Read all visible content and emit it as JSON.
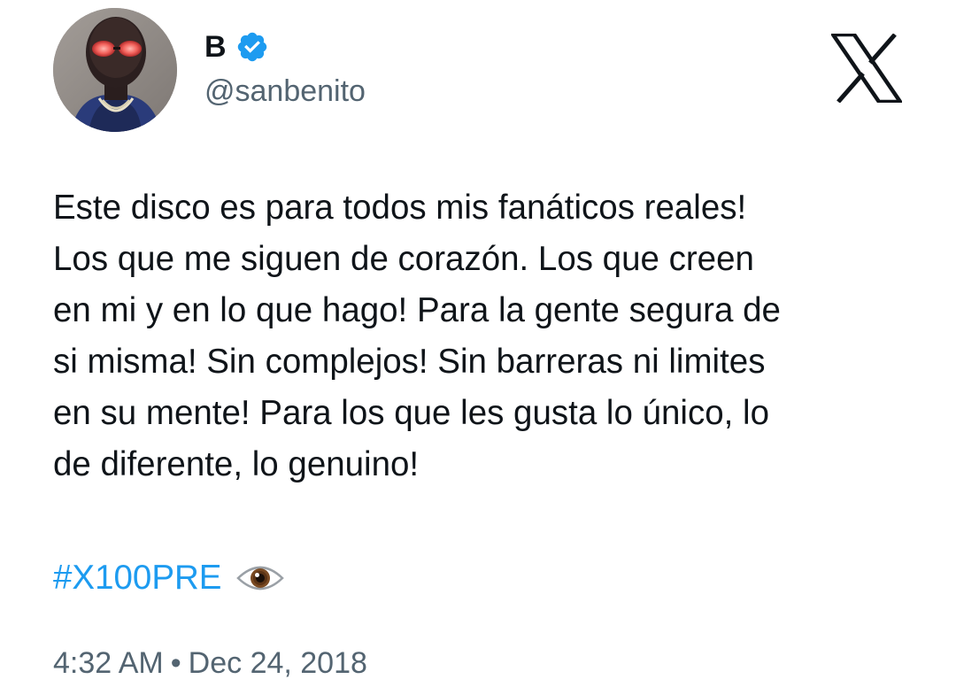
{
  "author": {
    "display_name": "B",
    "handle": "@sanbenito",
    "verified": true,
    "avatar_icon": "profile-photo-masked-person"
  },
  "platform_logo": "x-logo-icon",
  "tweet": {
    "lines": [
      "Este disco es para todos mis fanáticos reales!",
      "Los que me siguen de corazón. Los que creen",
      "en mi y en lo que hago! Para la gente segura de",
      "si misma! Sin complejos! Sin barreras ni limites",
      "en su mente! Para los que les gusta lo único, lo",
      "de diferente, lo genuino!"
    ],
    "hashtag": "#X100PRE",
    "emoji_icon": "eye-emoji"
  },
  "meta": {
    "time": "4:32 AM",
    "separator": "•",
    "date": "Dec 24, 2018"
  },
  "colors": {
    "link": "#1d9bf0",
    "verified": "#1d9bf0",
    "secondary_text": "#536471",
    "primary_text": "#0f1419"
  }
}
